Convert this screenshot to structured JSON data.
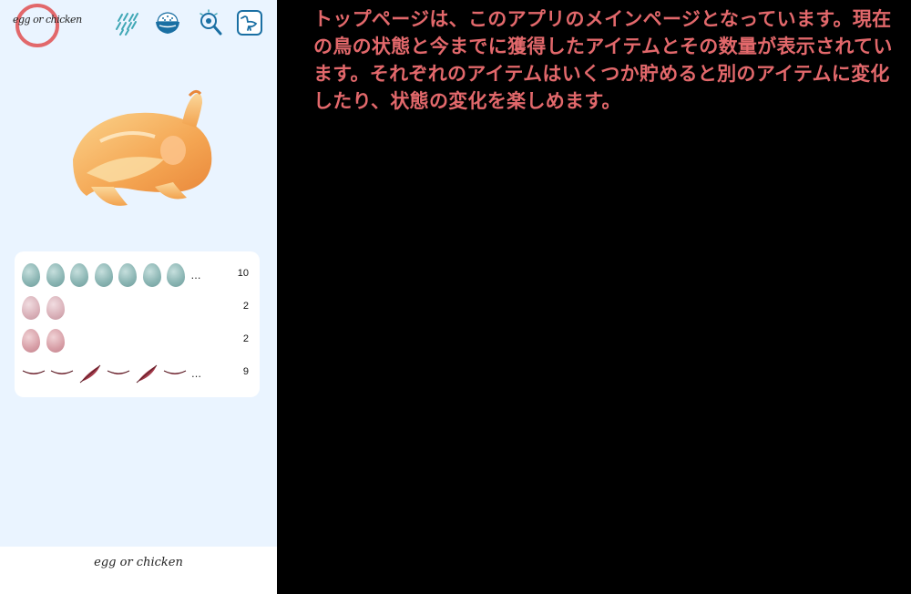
{
  "app": {
    "logo_text": "egg or chicken",
    "accent_color": "#e2686b"
  },
  "header_icons": [
    {
      "name": "rain-icon"
    },
    {
      "name": "rice-bowl-icon"
    },
    {
      "name": "magnifier-icon"
    },
    {
      "name": "bird-icon"
    }
  ],
  "inventory": [
    {
      "item": "teal-egg",
      "count": "10",
      "ellipsis": "…"
    },
    {
      "item": "pale-pink-egg",
      "count": "2"
    },
    {
      "item": "pink-egg",
      "count": "2"
    },
    {
      "item": "feather",
      "count": "9",
      "ellipsis": "…"
    }
  ],
  "tabbar": {
    "title": "egg or chicken"
  },
  "description": "トップページは、このアプリのメインページとなっています。現在の鳥の状態と今までに獲得したアイテムとその数量が表示されています。それぞれのアイテムはいくつか貯めると別のアイテムに変化したり、状態の変化を楽しめます。"
}
